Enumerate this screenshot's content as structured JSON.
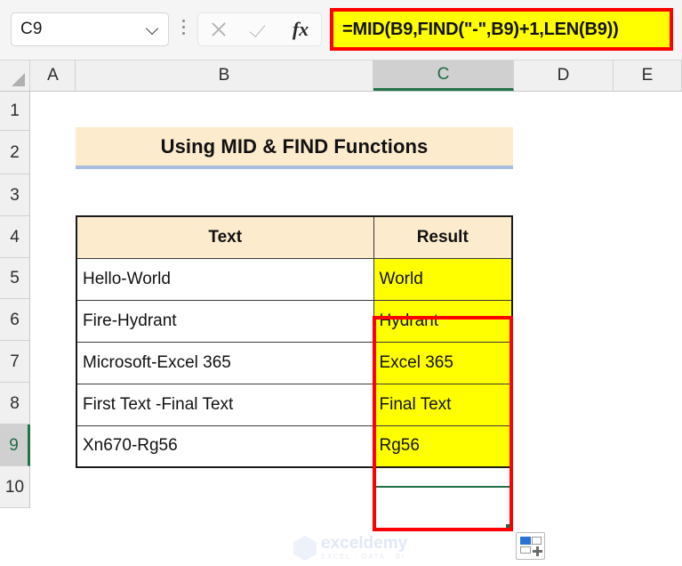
{
  "formula_bar": {
    "name_box_value": "C9",
    "formula": "=MID(B9,FIND(\"-\",B9)+1,LEN(B9))",
    "cancel_icon": "cancel-x-icon",
    "enter_icon": "enter-check-icon",
    "insert_function_icon": "fx",
    "more_options_icon": "kebab-menu-icon",
    "dropdown_icon": "chevron-down-icon"
  },
  "grid": {
    "column_headers": [
      "A",
      "B",
      "C",
      "D",
      "E"
    ],
    "selected_column": "C",
    "row_headers": [
      "1",
      "2",
      "3",
      "4",
      "5",
      "6",
      "7",
      "8",
      "9",
      "10"
    ],
    "selected_row": "9",
    "select_all_icon": "select-all-triangle-icon"
  },
  "sheet": {
    "title": "Using MID & FIND Functions",
    "table": {
      "headers": [
        "Text",
        "Result"
      ],
      "rows": [
        {
          "text": "Hello-World",
          "result": "World"
        },
        {
          "text": "Fire-Hydrant",
          "result": "Hydrant"
        },
        {
          "text": "Microsoft-Excel 365",
          "result": "Excel 365"
        },
        {
          "text": "First Text -Final Text",
          "result": "Final Text"
        },
        {
          "text": "Xn670-Rg56",
          "result": "Rg56"
        }
      ]
    }
  },
  "watermark": {
    "name": "exceldemy",
    "tagline": "EXCEL - DATA - BI",
    "logo_icon": "exceldemy-hex-logo-icon"
  },
  "quick_analysis": {
    "icon": "quick-analysis-icon"
  },
  "colors": {
    "highlight_yellow": "#ffff00",
    "annotation_red": "#ff0000",
    "header_cream": "#fdebcd",
    "title_underline_blue": "#a8bde0",
    "excel_green": "#217346"
  }
}
